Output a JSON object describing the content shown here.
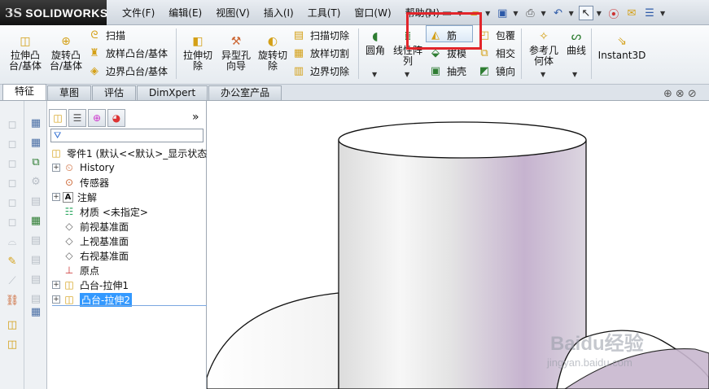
{
  "titlebar": {
    "logo_ds": "3S",
    "logo_name": "SOLIDWORKS",
    "menu": [
      "文件(F)",
      "编辑(E)",
      "视图(V)",
      "插入(I)",
      "工具(T)",
      "窗口(W)",
      "帮助(H)"
    ]
  },
  "ribbon": {
    "extrude_boss": "拉伸凸\n台/基体",
    "revolve_boss": "旋转凸\n台/基体",
    "sweep": "扫描",
    "loft_boss": "放样凸台/基体",
    "boundary_boss": "边界凸台/基体",
    "extrude_cut": "拉伸切\n除",
    "hole_wizard": "异型孔\n向导",
    "revolve_cut": "旋转切\n除",
    "sweep_cut": "扫描切除",
    "loft_cut": "放样切割",
    "boundary_cut": "边界切除",
    "fillet": "圆角",
    "linear_pattern": "线性阵\n列",
    "rib": "筋",
    "draft": "拔模",
    "shell": "抽壳",
    "wrap": "包覆",
    "intersect": "相交",
    "mirror": "镜向",
    "ref_geometry": "参考几\n何体",
    "curves": "曲线",
    "instant3d": "Instant3D"
  },
  "tabs": [
    "特征",
    "草图",
    "评估",
    "DimXpert",
    "办公室产品"
  ],
  "tree": {
    "part": "零件1 (默认<<默认>_显示状态",
    "items": [
      {
        "label": "History",
        "icon": "history-icon",
        "expandable": true
      },
      {
        "label": "传感器",
        "icon": "sensor-icon",
        "expandable": false
      },
      {
        "label": "注解",
        "icon": "annotation-icon",
        "expandable": true
      },
      {
        "label": "材质 <未指定>",
        "icon": "material-icon",
        "expandable": false
      },
      {
        "label": "前视基准面",
        "icon": "plane-icon",
        "expandable": false
      },
      {
        "label": "上视基准面",
        "icon": "plane-icon",
        "expandable": false
      },
      {
        "label": "右视基准面",
        "icon": "plane-icon",
        "expandable": false
      },
      {
        "label": "原点",
        "icon": "origin-icon",
        "expandable": false
      },
      {
        "label": "凸台-拉伸1",
        "icon": "extrude-feature-icon",
        "expandable": true
      },
      {
        "label": "凸台-拉伸2",
        "icon": "extrude-feature-icon",
        "expandable": true,
        "selected": true
      }
    ]
  },
  "watermark": {
    "brand": "Baidu经验",
    "url": "jingyan.baidu.com"
  },
  "colors": {
    "highlight_box": "#e2252b",
    "selection": "#3399ff",
    "cylinder_tint": "#c8b7cf"
  }
}
